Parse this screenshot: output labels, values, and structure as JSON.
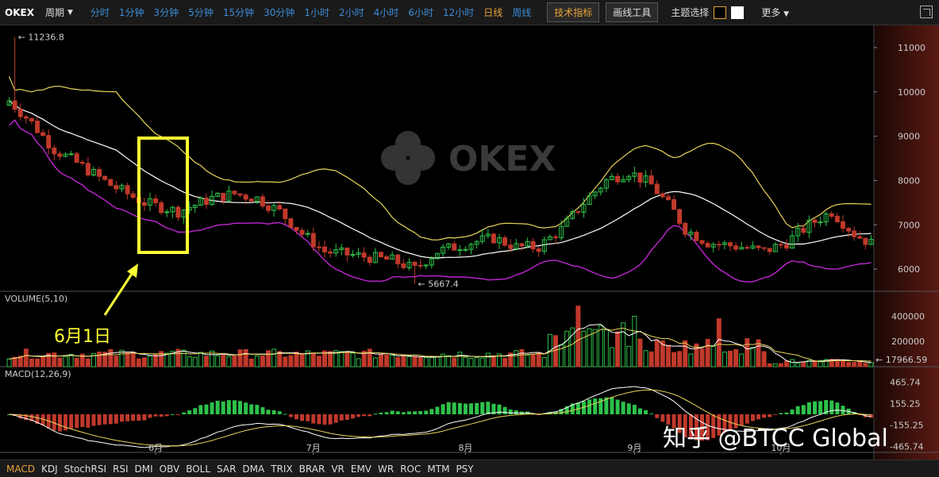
{
  "toolbar": {
    "brand": "OKEX",
    "period_label": "周期",
    "period_caret": "▼",
    "timeframes": [
      "分时",
      "1分钟",
      "3分钟",
      "5分钟",
      "15分钟",
      "30分钟",
      "1小时",
      "2小时",
      "4小时",
      "6小时",
      "12小时",
      "日线",
      "周线"
    ],
    "active_timeframe": "日线",
    "tech_label": "技术指标",
    "draw_label": "画线工具",
    "theme_label": "主题选择",
    "theme_colors": [
      "#000000",
      "#ffffff"
    ],
    "more_label": "更多",
    "more_caret": "▼"
  },
  "indicators": [
    "MACD",
    "KDJ",
    "StochRSI",
    "RSI",
    "DMI",
    "OBV",
    "BOLL",
    "SAR",
    "DMA",
    "TRIX",
    "BRAR",
    "VR",
    "EMV",
    "WR",
    "ROC",
    "MTM",
    "PSY"
  ],
  "active_indicator": "MACD",
  "watermark": {
    "okex": "OKEX",
    "zhihu": "知乎 @BTCC Global"
  },
  "annotation": {
    "text": "6月1日",
    "color": "#ffff33"
  },
  "colors": {
    "up": "#2ec24a",
    "down": "#c0392b",
    "boll_upper": "#e8d55a",
    "boll_mid": "#ffffff",
    "boll_lower": "#c026d3",
    "vol_ma": "#ffffff",
    "vol_ma2": "#e8d55a",
    "dif": "#ffffff",
    "dea": "#e8d55a"
  },
  "chart_data": {
    "type": "candlestick",
    "price": {
      "ylim": [
        5500,
        11500
      ],
      "yticks": [
        "11000",
        "10000",
        "9000",
        "8000",
        "7000",
        "6000"
      ],
      "high_label": "← 11236.8",
      "low_label": "← 5667.4",
      "high": 11236.8,
      "low": 5667.4
    },
    "xticks": [
      "6月",
      "7月",
      "8月",
      "9月",
      "10月"
    ],
    "volume": {
      "title": "VOLUME(5,10)",
      "yticks": [
        "400000",
        "200000"
      ],
      "last_label": "← 17966.59",
      "last": 17966.59
    },
    "macd": {
      "title": "MACD(12,26,9)",
      "yticks": [
        "465.74",
        "155.25",
        "-155.25",
        "-465.74"
      ]
    }
  }
}
